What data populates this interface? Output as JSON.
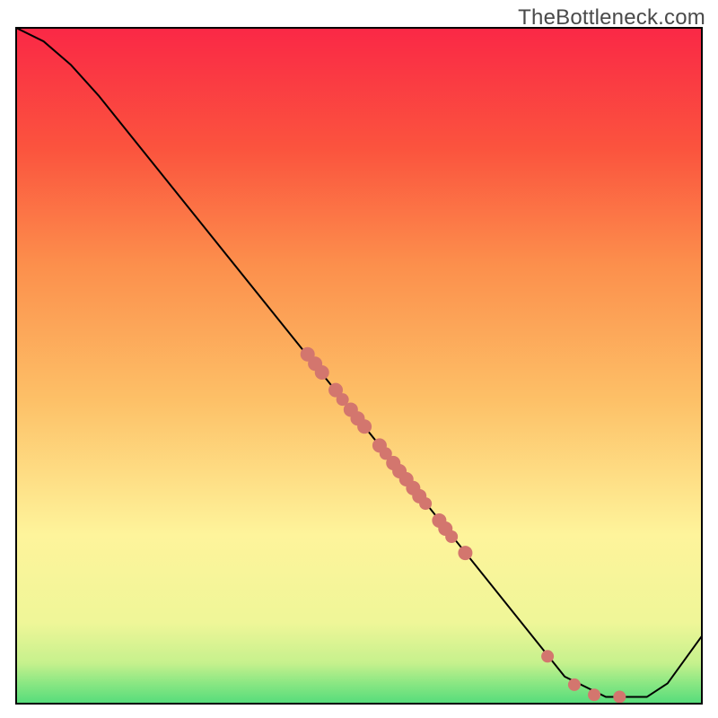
{
  "branding": {
    "watermark": "TheBottleneck.com"
  },
  "chart_data": {
    "type": "line",
    "title": "",
    "xlabel": "",
    "ylabel": "",
    "xlim": [
      0,
      100
    ],
    "ylim": [
      0,
      100
    ],
    "grid": false,
    "legend": false,
    "background_gradient": {
      "stops": [
        {
          "offset": 0,
          "color": "#55dc7b"
        },
        {
          "offset": 0.03,
          "color": "#8ae783"
        },
        {
          "offset": 0.06,
          "color": "#c6f18d"
        },
        {
          "offset": 0.12,
          "color": "#eff698"
        },
        {
          "offset": 0.25,
          "color": "#fef49b"
        },
        {
          "offset": 0.45,
          "color": "#fdc067"
        },
        {
          "offset": 0.65,
          "color": "#fc8f4c"
        },
        {
          "offset": 0.82,
          "color": "#fb543e"
        },
        {
          "offset": 1.0,
          "color": "#fa2846"
        }
      ]
    },
    "series": [
      {
        "name": "bottleneck-curve",
        "x": [
          0,
          4,
          8,
          12,
          50,
          80,
          86,
          92,
          95,
          100
        ],
        "y": [
          100,
          98,
          94.5,
          90,
          42,
          4,
          1,
          1,
          3,
          10
        ]
      }
    ],
    "scatter": {
      "name": "curve-markers",
      "points": [
        {
          "x": 42.5,
          "y": 51.7,
          "r": 8
        },
        {
          "x": 43.6,
          "y": 50.3,
          "r": 8
        },
        {
          "x": 44.6,
          "y": 49.0,
          "r": 8
        },
        {
          "x": 46.6,
          "y": 46.4,
          "r": 8
        },
        {
          "x": 47.6,
          "y": 45.0,
          "r": 7
        },
        {
          "x": 48.8,
          "y": 43.5,
          "r": 8
        },
        {
          "x": 49.8,
          "y": 42.2,
          "r": 8
        },
        {
          "x": 50.8,
          "y": 41.0,
          "r": 8
        },
        {
          "x": 53.0,
          "y": 38.2,
          "r": 8
        },
        {
          "x": 53.9,
          "y": 37.0,
          "r": 7
        },
        {
          "x": 55.0,
          "y": 35.6,
          "r": 8
        },
        {
          "x": 55.9,
          "y": 34.4,
          "r": 8
        },
        {
          "x": 56.9,
          "y": 33.2,
          "r": 8
        },
        {
          "x": 57.9,
          "y": 31.9,
          "r": 8
        },
        {
          "x": 58.8,
          "y": 30.7,
          "r": 8
        },
        {
          "x": 59.7,
          "y": 29.6,
          "r": 7
        },
        {
          "x": 61.7,
          "y": 27.1,
          "r": 8
        },
        {
          "x": 62.6,
          "y": 25.9,
          "r": 8
        },
        {
          "x": 63.5,
          "y": 24.7,
          "r": 7
        },
        {
          "x": 65.5,
          "y": 22.3,
          "r": 8
        },
        {
          "x": 77.5,
          "y": 7.0,
          "r": 7
        },
        {
          "x": 81.4,
          "y": 2.8,
          "r": 7
        },
        {
          "x": 84.3,
          "y": 1.3,
          "r": 7
        },
        {
          "x": 88.0,
          "y": 1.0,
          "r": 7
        }
      ]
    }
  }
}
